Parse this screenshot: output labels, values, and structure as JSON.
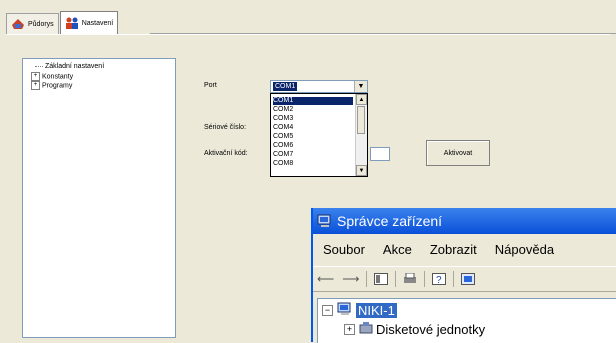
{
  "tabs": [
    {
      "label": "Půdorys",
      "icon": "floorplan-icon"
    },
    {
      "label": "Nastavení",
      "icon": "settings-people-icon"
    }
  ],
  "tree": {
    "items": [
      {
        "label": "Základní nastavení",
        "expandable": false
      },
      {
        "label": "Konstanty",
        "expandable": true
      },
      {
        "label": "Programy",
        "expandable": true
      }
    ]
  },
  "form": {
    "port_label": "Port",
    "port_value": "COM1",
    "serial_label": "Sériové číslo:",
    "activation_label": "Aktivační kód:",
    "activate_button": "Aktivovat",
    "port_options": [
      "COM1",
      "COM2",
      "COM3",
      "COM4",
      "COM5",
      "COM6",
      "COM7",
      "COM8"
    ]
  },
  "device_manager": {
    "title": "Správce zařízení",
    "menu": [
      "Soubor",
      "Akce",
      "Zobrazit",
      "Nápověda"
    ],
    "tree": [
      {
        "label": "NIKI-1",
        "selected": true
      },
      {
        "label": "Disketové jednotky",
        "selected": false
      }
    ]
  }
}
